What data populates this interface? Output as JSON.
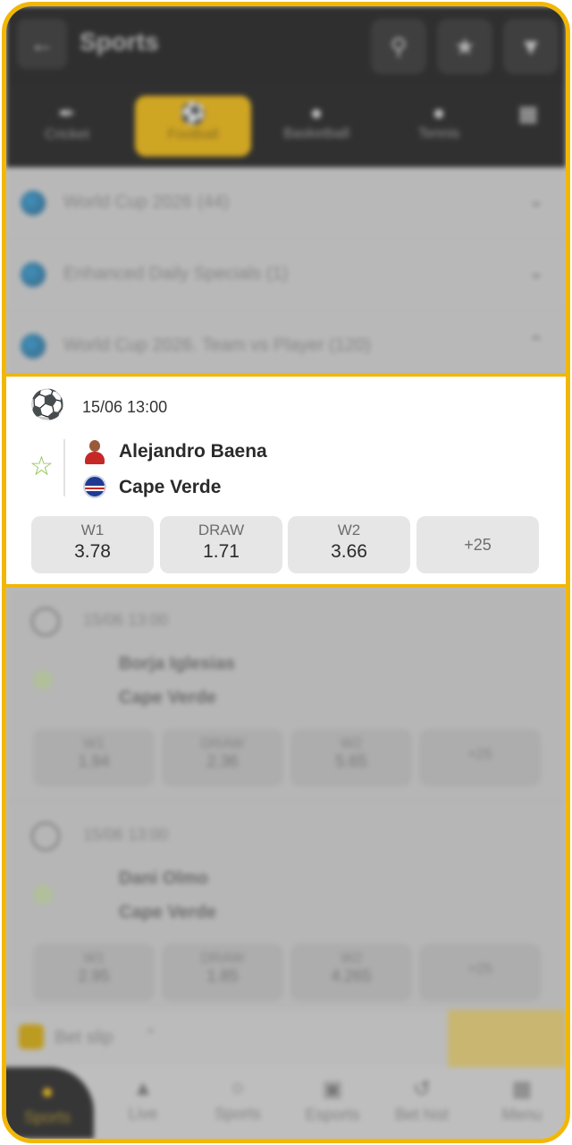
{
  "header": {
    "back_icon": "arrow-left-icon",
    "title": "Sports",
    "actions": [
      "search-icon",
      "star-icon",
      "filter-icon"
    ]
  },
  "sports_tabs": [
    {
      "label": "Cricket",
      "icon": "cricket-icon"
    },
    {
      "label": "Football",
      "icon": "football-icon",
      "active": true
    },
    {
      "label": "Basketball",
      "icon": "basketball-icon"
    },
    {
      "label": "Tennis",
      "icon": "tennis-icon"
    },
    {
      "label": "",
      "icon": "grid-icon"
    }
  ],
  "leagues": [
    {
      "name": "World Cup 2026 (44)",
      "expanded": false
    },
    {
      "name": "Enhanced Daily Specials (1)",
      "expanded": false
    },
    {
      "name": "World Cup 2026. Team vs Player (120)",
      "expanded": true
    }
  ],
  "featured_event": {
    "datetime": "15/06 13:00",
    "team1": "Alejandro Baena",
    "team2": "Cape Verde",
    "odds": [
      {
        "label": "W1",
        "value": "3.78"
      },
      {
        "label": "DRAW",
        "value": "1.71"
      },
      {
        "label": "W2",
        "value": "3.66"
      }
    ],
    "more": "+25"
  },
  "blurred_events": [
    {
      "datetime": "15/06 13:00",
      "team1": "Borja Iglesias",
      "team2": "Cape Verde",
      "odds": [
        "W1",
        "DRAW",
        "W2",
        "+25"
      ],
      "values": [
        "1.94",
        "2.36",
        "5.65",
        ""
      ]
    },
    {
      "datetime": "15/06 13:00",
      "team1": "Dani Olmo",
      "team2": "Cape Verde",
      "odds": [
        "W1",
        "DRAW",
        "W2",
        "+25"
      ],
      "values": [
        "2.95",
        "1.85",
        "4.265",
        ""
      ]
    }
  ],
  "bet_slip": {
    "label": "Bet slip"
  },
  "bottom_nav": [
    {
      "label": "Sports",
      "icon": "home-icon",
      "active": true
    },
    {
      "label": "Live",
      "icon": "live-icon"
    },
    {
      "label": "Sports",
      "icon": "sports-icon"
    },
    {
      "label": "Esports",
      "icon": "esports-icon"
    },
    {
      "label": "Bet hist",
      "icon": "history-icon"
    },
    {
      "label": "Menu",
      "icon": "menu-icon"
    }
  ],
  "colors": {
    "accent": "#f2b705",
    "favorite": "#8bc34a",
    "frame": "#f2b705"
  }
}
